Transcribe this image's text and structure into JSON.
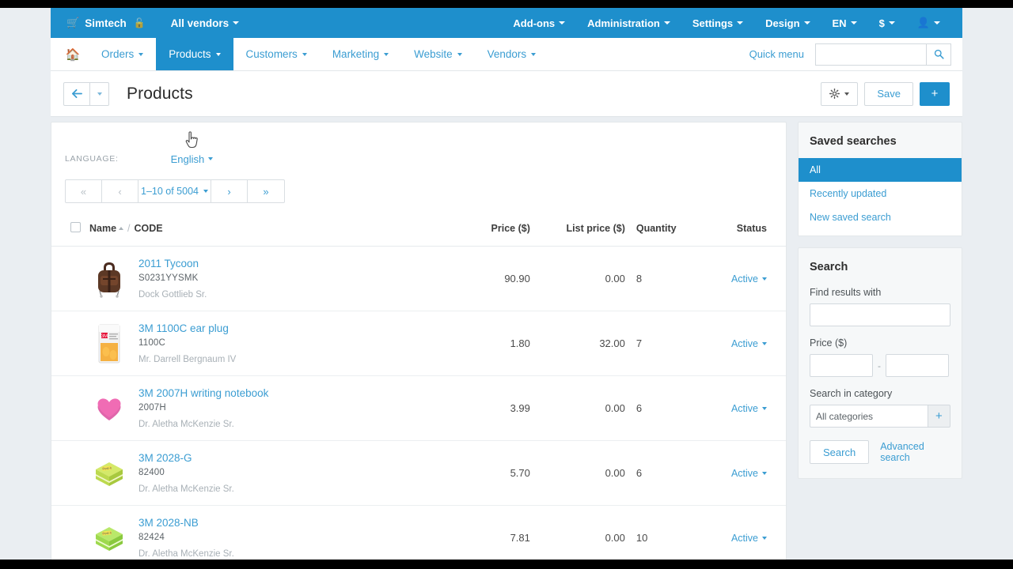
{
  "topbar": {
    "cart_icon": "cart-icon",
    "brand": "Simtech",
    "lock_icon": "lock-icon",
    "vendors_label": "All vendors",
    "menu": [
      {
        "label": "Add-ons"
      },
      {
        "label": "Administration"
      },
      {
        "label": "Settings"
      },
      {
        "label": "Design"
      },
      {
        "label": "EN"
      },
      {
        "label": "$"
      }
    ],
    "account_icon": "user-icon",
    "bg_color": "#1e8fcc"
  },
  "nav": {
    "home_icon": "home-icon",
    "items": [
      {
        "label": "Orders",
        "active": false
      },
      {
        "label": "Products",
        "active": true
      },
      {
        "label": "Customers",
        "active": false
      },
      {
        "label": "Marketing",
        "active": false
      },
      {
        "label": "Website",
        "active": false
      },
      {
        "label": "Vendors",
        "active": false
      }
    ],
    "quick_menu": "Quick menu",
    "search_value": "",
    "search_placeholder": "",
    "search_icon": "search-icon"
  },
  "page_header": {
    "back_icon": "arrow-left-icon",
    "title": "Products",
    "gear_icon": "gear-icon",
    "save_label": "Save",
    "plus_label": "+"
  },
  "toolbar": {
    "language_label": "Language:",
    "language_value": "English",
    "pager": {
      "first": "«",
      "prev": "‹",
      "count": "1–10 of 5004",
      "next": "›",
      "last": "»"
    }
  },
  "table": {
    "headers": {
      "name": "Name",
      "code": "CODE",
      "price": "Price ($)",
      "list_price": "List price ($)",
      "quantity": "Quantity",
      "status": "Status"
    },
    "sort": "asc",
    "rows": [
      {
        "name": "2011 Tycoon",
        "code": "S0231YYSMK",
        "vendor": "Dock Gottlieb Sr.",
        "price": "90.90",
        "list_price": "0.00",
        "quantity": "8",
        "status": "Active",
        "thumb": "backpack-thumbnail"
      },
      {
        "name": "3M 1100C ear plug",
        "code": "1100C",
        "vendor": "Mr. Darrell Bergnaum IV",
        "price": "1.80",
        "list_price": "32.00",
        "quantity": "7",
        "status": "Active",
        "thumb": "earplug-package-thumbnail"
      },
      {
        "name": "3M 2007H writing notebook",
        "code": "2007H",
        "vendor": "Dr. Aletha McKenzie Sr.",
        "price": "3.99",
        "list_price": "0.00",
        "quantity": "6",
        "status": "Active",
        "thumb": "pink-heart-notes-thumbnail"
      },
      {
        "name": "3M 2028-G",
        "code": "82400",
        "vendor": "Dr. Aletha McKenzie Sr.",
        "price": "5.70",
        "list_price": "0.00",
        "quantity": "6",
        "status": "Active",
        "thumb": "green-sticky-notes-thumbnail"
      },
      {
        "name": "3M 2028-NB",
        "code": "82424",
        "vendor": "Dr. Aletha McKenzie Sr.",
        "price": "7.81",
        "list_price": "0.00",
        "quantity": "10",
        "status": "Active",
        "thumb": "green-sticky-notes-thumbnail"
      }
    ]
  },
  "sidebar": {
    "saved_searches": {
      "title": "Saved searches",
      "items": [
        {
          "label": "All",
          "active": true
        },
        {
          "label": "Recently updated",
          "active": false
        },
        {
          "label": "New saved search",
          "active": false
        }
      ]
    },
    "search": {
      "title": "Search",
      "find_label": "Find results with",
      "find_value": "",
      "price_label": "Price ($)",
      "price_from": "",
      "price_to": "",
      "price_separator": "-",
      "category_label": "Search in category",
      "category_value": "All categories",
      "category_add_icon": "plus-icon",
      "search_button": "Search",
      "advanced_link": "Advanced search"
    }
  },
  "colors": {
    "accent": "#1e8fcc",
    "link": "#3b9dd2",
    "page_bg": "#eaeef2"
  }
}
